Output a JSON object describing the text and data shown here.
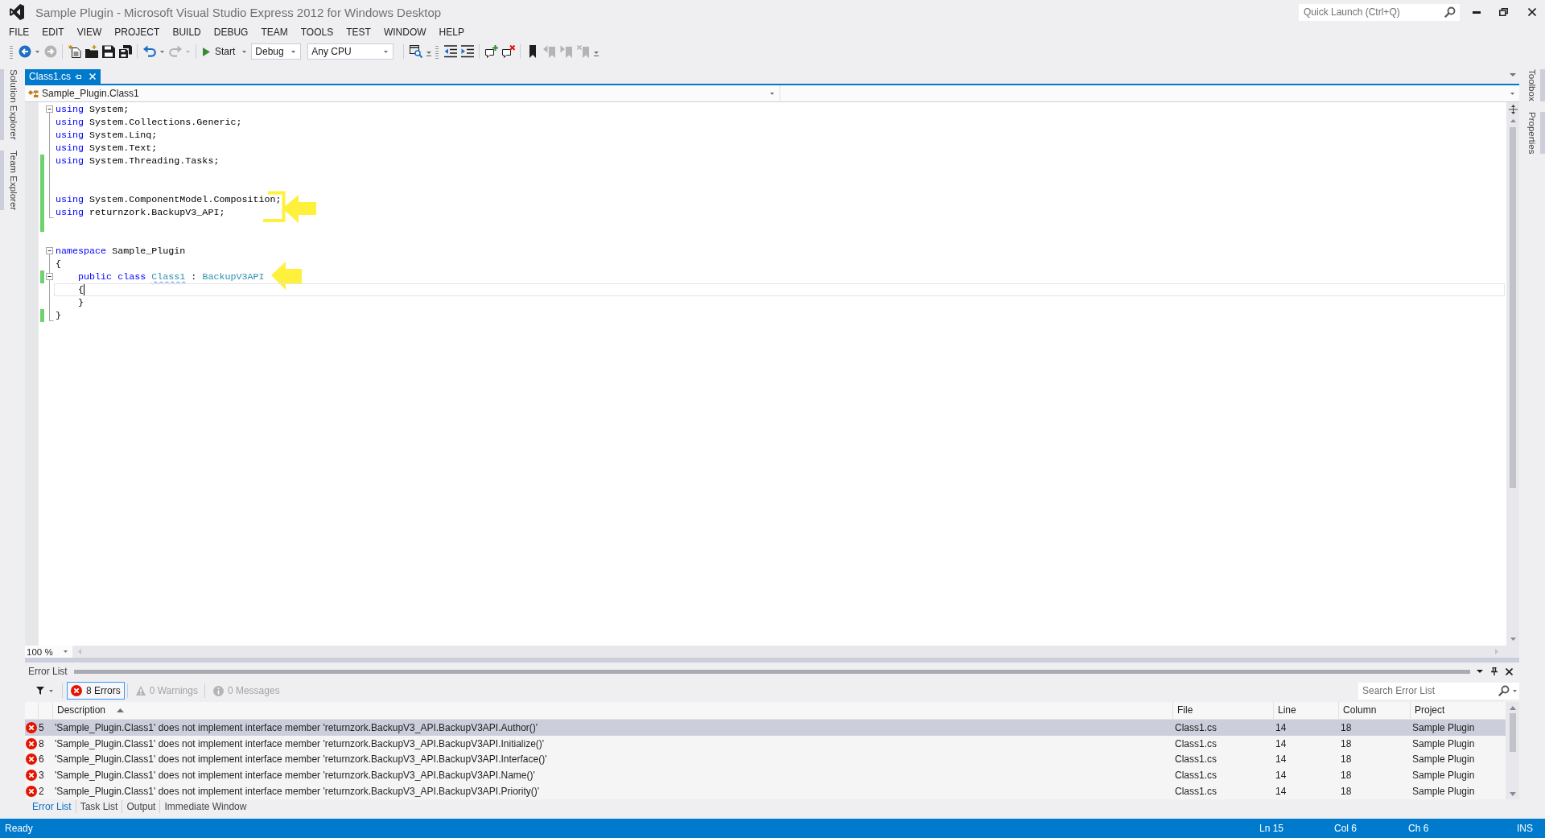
{
  "window": {
    "title": "Sample Plugin - Microsoft Visual Studio Express 2012 for Windows Desktop",
    "quick_launch": {
      "placeholder": "Quick Launch (Ctrl+Q)"
    }
  },
  "menu": [
    "FILE",
    "EDIT",
    "VIEW",
    "PROJECT",
    "BUILD",
    "DEBUG",
    "TEAM",
    "TOOLS",
    "TEST",
    "WINDOW",
    "HELP"
  ],
  "toolbar": [
    {
      "kind": "grip"
    },
    {
      "kind": "icon",
      "disabled": false,
      "menu": true
    },
    {
      "kind": "icon",
      "disabled": true,
      "menu": false
    },
    {
      "kind": "separator"
    },
    {
      "kind": "icon",
      "disabled": false,
      "menu": false
    },
    {
      "kind": "icon",
      "disabled": false,
      "menu": false
    },
    {
      "kind": "icon",
      "disabled": false,
      "menu": false
    },
    {
      "kind": "icon",
      "disabled": false,
      "menu": false
    },
    {
      "kind": "separator"
    },
    {
      "kind": "icon",
      "disabled": false,
      "menu": true
    },
    {
      "kind": "icon",
      "disabled": true,
      "menu": true
    },
    {
      "kind": "separator"
    },
    {
      "kind": "button",
      "label": "Start",
      "menu": true
    },
    {
      "kind": "combo",
      "value": "Debug"
    },
    {
      "kind": "combo",
      "value": "Any CPU"
    },
    {
      "kind": "separator"
    },
    {
      "kind": "icon",
      "disabled": false,
      "menu": false
    },
    {
      "kind": "overflow"
    },
    {
      "kind": "grip"
    },
    {
      "kind": "icon",
      "disabled": false,
      "menu": false
    },
    {
      "kind": "icon",
      "disabled": false,
      "menu": false
    },
    {
      "kind": "separator"
    },
    {
      "kind": "icon",
      "disabled": false,
      "menu": false
    },
    {
      "kind": "icon",
      "disabled": false,
      "menu": false
    },
    {
      "kind": "separator"
    },
    {
      "kind": "icon",
      "disabled": false,
      "menu": false
    },
    {
      "kind": "icon",
      "disabled": true,
      "menu": false
    },
    {
      "kind": "icon",
      "disabled": true,
      "menu": false
    },
    {
      "kind": "icon",
      "disabled": true,
      "menu": false
    },
    {
      "kind": "overflow"
    }
  ],
  "left_sidebar": [
    {
      "label": "Solution Explorer"
    },
    {
      "label": "Team Explorer"
    }
  ],
  "right_sidebar": [
    {
      "label": "Toolbox"
    },
    {
      "label": "Properties"
    }
  ],
  "document_tabs": [
    {
      "label": "Class1.cs",
      "selected": true
    }
  ],
  "navigation_bar": {
    "class_dropdown": "Sample_Plugin.Class1"
  },
  "editor": {
    "lines": [
      {
        "tokens": [
          {
            "kind": "keyword",
            "text": "using"
          },
          {
            "kind": "plain",
            "text": " System;"
          }
        ],
        "changed": false,
        "current": false,
        "expanded": true,
        "children": [
          {
            "tokens": [
              {
                "kind": "keyword",
                "text": "using"
              },
              {
                "kind": "plain",
                "text": " System.Collections.Generic;"
              }
            ],
            "changed": false,
            "current": false
          },
          {
            "tokens": [
              {
                "kind": "keyword",
                "text": "using"
              },
              {
                "kind": "plain",
                "text": " System.Linq;"
              }
            ],
            "changed": false,
            "current": false
          },
          {
            "tokens": [
              {
                "kind": "keyword",
                "text": "using"
              },
              {
                "kind": "plain",
                "text": " System.Text;"
              }
            ],
            "changed": false,
            "current": false
          },
          {
            "tokens": [
              {
                "kind": "keyword",
                "text": "using"
              },
              {
                "kind": "plain",
                "text": " System.Threading.Tasks;"
              }
            ],
            "changed": true,
            "current": false
          },
          {
            "changed": true,
            "current": false
          },
          {
            "changed": true,
            "current": false
          },
          {
            "tokens": [
              {
                "kind": "keyword",
                "text": "using"
              },
              {
                "kind": "plain",
                "text": " System.ComponentModel.Composition;"
              }
            ],
            "changed": true,
            "current": false,
            "annotation": {
              "kind": "bracket-arrow"
            }
          },
          {
            "tokens": [
              {
                "kind": "keyword",
                "text": "using"
              },
              {
                "kind": "plain",
                "text": " returnzork.BackupV3_API;"
              }
            ],
            "changed": true,
            "current": false
          }
        ]
      },
      {
        "changed": true,
        "current": false
      },
      {
        "changed": false,
        "current": false
      },
      {
        "tokens": [
          {
            "kind": "keyword",
            "text": "namespace"
          },
          {
            "kind": "plain",
            "text": " Sample_Plugin"
          }
        ],
        "changed": false,
        "current": false,
        "expanded": true,
        "children": [
          {
            "tokens": [
              {
                "kind": "plain",
                "text": "{"
              }
            ],
            "changed": false,
            "current": false
          },
          {
            "tokens": [
              {
                "kind": "keyword",
                "text": "    public class "
              },
              {
                "kind": "error-type",
                "text": "Class1"
              },
              {
                "kind": "plain",
                "text": " : "
              },
              {
                "kind": "type",
                "text": "BackupV3API"
              }
            ],
            "changed": true,
            "current": false,
            "expanded": true,
            "annotation": {
              "kind": "arrow"
            },
            "children": [
              {
                "tokens": [
                  {
                    "kind": "plain",
                    "text": "    {"
                  }
                ],
                "changed": false,
                "current": true
              },
              {
                "tokens": [
                  {
                    "kind": "plain",
                    "text": "    }"
                  }
                ],
                "changed": false,
                "current": false
              }
            ]
          },
          {
            "tokens": [
              {
                "kind": "plain",
                "text": "}"
              }
            ],
            "changed": true,
            "current": false
          }
        ]
      }
    ],
    "zoom": "100 %"
  },
  "error_list": {
    "title": "Error List",
    "filters": [
      {
        "kind": "error",
        "label": "8 Errors",
        "selected": true,
        "disabled": false
      },
      {
        "kind": "warning",
        "label": "0 Warnings",
        "selected": false,
        "disabled": true
      },
      {
        "kind": "message",
        "label": "0 Messages",
        "selected": false,
        "disabled": true
      }
    ],
    "search": {
      "placeholder": "Search Error List"
    },
    "columns": [
      {
        "label": "Description",
        "sorted": true
      },
      {
        "label": "File",
        "sorted": false
      },
      {
        "label": "Line",
        "sorted": false
      },
      {
        "label": "Column",
        "sorted": false
      },
      {
        "label": "Project",
        "sorted": false
      }
    ],
    "rows": [
      {
        "selected": true,
        "column_2": "5",
        "description": "'Sample_Plugin.Class1' does not implement interface member 'returnzork.BackupV3_API.BackupV3API.Author()'",
        "file": "Class1.cs",
        "line": "14",
        "column": "18",
        "project": "Sample Plugin"
      },
      {
        "selected": false,
        "column_2": "8",
        "description": "'Sample_Plugin.Class1' does not implement interface member 'returnzork.BackupV3_API.BackupV3API.Initialize()'",
        "file": "Class1.cs",
        "line": "14",
        "column": "18",
        "project": "Sample Plugin"
      },
      {
        "selected": false,
        "column_2": "6",
        "description": "'Sample_Plugin.Class1' does not implement interface member 'returnzork.BackupV3_API.BackupV3API.Interface()'",
        "file": "Class1.cs",
        "line": "14",
        "column": "18",
        "project": "Sample Plugin"
      },
      {
        "selected": false,
        "column_2": "3",
        "description": "'Sample_Plugin.Class1' does not implement interface member 'returnzork.BackupV3_API.BackupV3API.Name()'",
        "file": "Class1.cs",
        "line": "14",
        "column": "18",
        "project": "Sample Plugin"
      },
      {
        "selected": false,
        "column_2": "2",
        "description": "'Sample_Plugin.Class1' does not implement interface member 'returnzork.BackupV3_API.BackupV3API.Priority()'",
        "file": "Class1.cs",
        "line": "14",
        "column": "18",
        "project": "Sample Plugin"
      }
    ],
    "tabs": [
      {
        "label": "Error List",
        "selected": true
      },
      {
        "label": "Task List",
        "selected": false
      },
      {
        "label": "Output",
        "selected": false
      },
      {
        "label": "Immediate Window",
        "selected": false
      }
    ]
  },
  "status_bar": {
    "message": "Ready",
    "items": [
      "Ln 15",
      "Col 6",
      "Ch 6",
      "INS"
    ]
  }
}
